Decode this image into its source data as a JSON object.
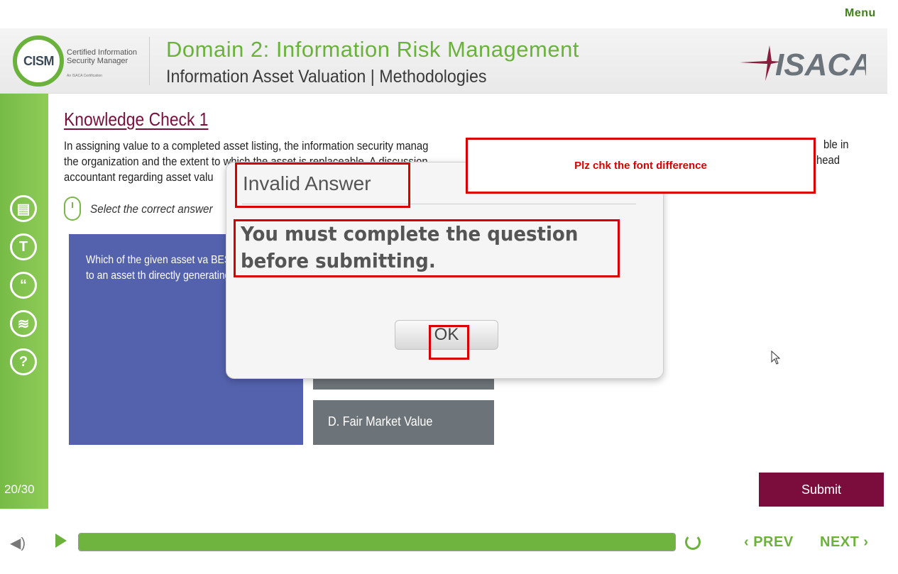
{
  "menu": {
    "label": "Menu"
  },
  "header": {
    "logo_text": "CISM",
    "logo_subtitle": "Certified Information Security Manager",
    "logo_tagline": "An ISACA Certification",
    "domain_title": "Domain 2: Information Risk Management",
    "subtitle": "Information Asset Valuation | Methodologies",
    "brand": "ISACA"
  },
  "sidebar": {
    "buttons": [
      {
        "name": "document-icon",
        "glyph": "▤"
      },
      {
        "name": "glossary-icon",
        "glyph": "T"
      },
      {
        "name": "quote-icon",
        "glyph": "“"
      },
      {
        "name": "layers-icon",
        "glyph": "≋"
      },
      {
        "name": "help-icon",
        "glyph": "?"
      }
    ],
    "page_count": "20/30"
  },
  "content": {
    "title": "Knowledge Check 1",
    "question_lines": [
      "In assigning value to a completed asset listing, the information security manag",
      "the organization and the extent to which the asset is replaceable. A discussion",
      "accountant regarding asset valu"
    ],
    "question_tail": [
      "ble in",
      "head"
    ],
    "instruction": "Select the correct answer",
    "card_text": "Which of the given asset va BEST applied to an asset th directly generating revenue",
    "options": [
      {
        "label": ""
      },
      {
        "label": "D.  Fair Market Value"
      }
    ],
    "submit_label": "Submit"
  },
  "dialog": {
    "title": "Invalid Answer",
    "message": "You must complete the question before submitting.",
    "ok_label": "OK"
  },
  "annotation": {
    "note": "Plz chk the font difference",
    "color": "#d80000"
  },
  "footer": {
    "progress_percent": 100,
    "prev_label": "PREV",
    "next_label": "NEXT"
  },
  "colors": {
    "accent_green": "#6ab23c",
    "maroon": "#7b0d3d",
    "card_blue": "#5462ae",
    "option_gray": "#6d7479"
  }
}
